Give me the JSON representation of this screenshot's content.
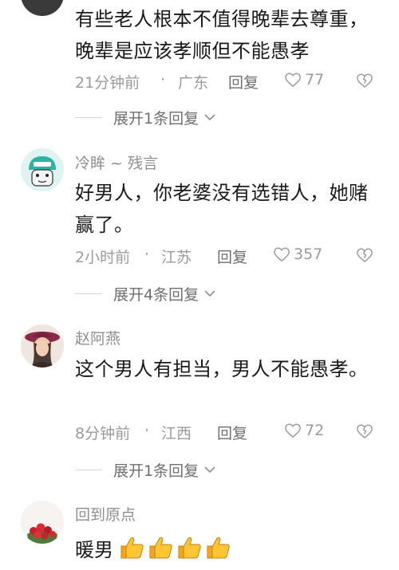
{
  "comments": [
    {
      "username": "",
      "text": "有些老人根本不值得晚辈去尊重，晚辈是应该孝顺但不能愚孝",
      "time": "21分钟前",
      "location": "广东",
      "reply_label": "回复",
      "likes": "77",
      "expand_label": "展开1条回复"
    },
    {
      "username": "冷眸 ~ 残言",
      "text": "好男人，你老婆没有选错人，她赌赢了。",
      "time": "2小时前",
      "location": "江苏",
      "reply_label": "回复",
      "likes": "357",
      "expand_label": "展开4条回复"
    },
    {
      "username": "赵阿燕",
      "text": "这个男人有担当，男人不能愚孝。",
      "time": "8分钟前",
      "location": "江西",
      "reply_label": "回复",
      "likes": "72",
      "expand_label": "展开1条回复"
    },
    {
      "username": "回到原点",
      "text": "暖男",
      "emojis": [
        "thumbs-up",
        "thumbs-up",
        "thumbs-up",
        "thumbs-up"
      ]
    }
  ],
  "meta_separator": "·",
  "colors": {
    "text": "#1a1a1a",
    "meta": "#9a9a9f",
    "emoji": "#f5b120"
  }
}
